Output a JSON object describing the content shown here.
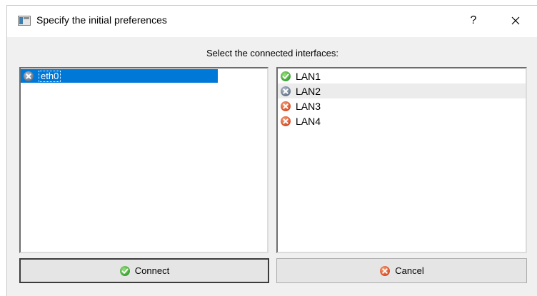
{
  "dialog": {
    "title": "Specify the initial preferences",
    "help_label": "?",
    "instruction": "Select the connected interfaces:"
  },
  "interfaces": [
    {
      "label": "eth0",
      "status": "disconnected",
      "selected": true
    }
  ],
  "ports": [
    {
      "label": "LAN1",
      "status": "connected"
    },
    {
      "label": "LAN2",
      "status": "disconnected"
    },
    {
      "label": "LAN3",
      "status": "error"
    },
    {
      "label": "LAN4",
      "status": "error"
    }
  ],
  "buttons": {
    "connect_label": "Connect",
    "cancel_label": "Cancel"
  },
  "colors": {
    "selection": "#0078d7",
    "connected_green": "#3cb043",
    "disconnected_gray": "#6f7f93",
    "error_red": "#e05a2b"
  },
  "icons": {
    "connected": "check-circle-icon",
    "disconnected": "x-circle-gray-icon",
    "error": "x-circle-red-icon",
    "help": "question-mark-icon",
    "close": "close-icon"
  }
}
